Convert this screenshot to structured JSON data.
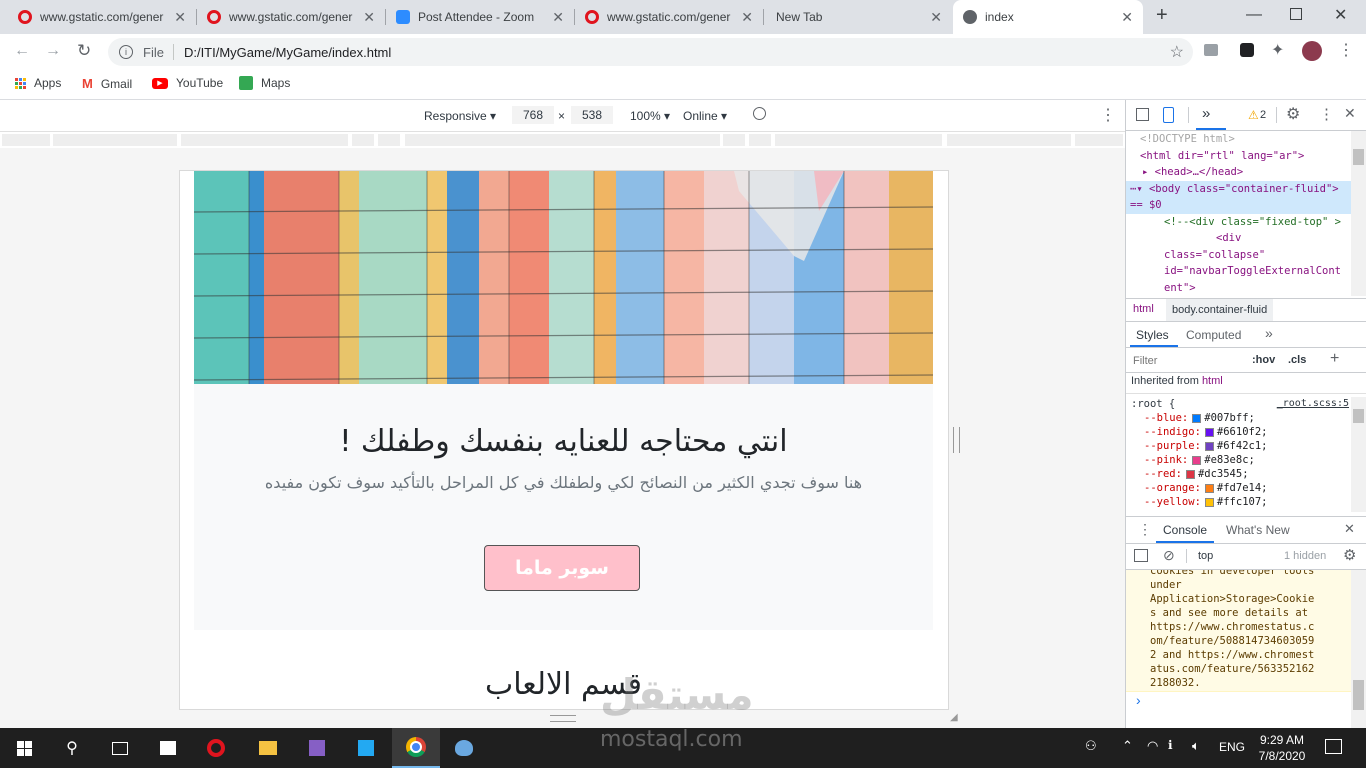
{
  "browser": {
    "tabs": [
      {
        "title": "www.gstatic.com/gener",
        "icon": "opera-icon"
      },
      {
        "title": "www.gstatic.com/gener",
        "icon": "opera-icon"
      },
      {
        "title": "Post Attendee - Zoom",
        "icon": "zoom-icon"
      },
      {
        "title": "www.gstatic.com/gener",
        "icon": "opera-icon"
      },
      {
        "title": "New Tab",
        "icon": ""
      },
      {
        "title": "index",
        "icon": "globe-icon"
      }
    ],
    "new_tab": "+",
    "address": {
      "scheme": "File",
      "path": "D:/ITI/MyGame/MyGame/index.html"
    },
    "bookmarks": [
      "Apps",
      "Gmail",
      "YouTube",
      "Maps"
    ]
  },
  "device_toolbar": {
    "mode": "Responsive",
    "width": "768",
    "times": "×",
    "height": "538",
    "zoom": "100%",
    "network": "Online"
  },
  "page": {
    "dir": "rtl",
    "headline": "انتي محتاجه للعنايه بنفسك وطفلك !",
    "lead": "هنا سوف تجدي الكثير من النصائح لكي ولطفلك في كل المراحل بالتأكيد سوف تكون مفيده",
    "cta": "سوبر ماما",
    "section_title": "قسم الالعاب",
    "colors": {
      "cta_bg": "#ffc0cb",
      "jumbo_bg": "#f8f9fa"
    }
  },
  "devtools": {
    "warnings": "2",
    "elements": [
      "<!DOCTYPE html>",
      "<html dir=\"rtl\" lang=\"ar\">",
      "<head>…</head>",
      "<body class=\"container-fluid\"> == $0",
      "<!--<div class=\"fixed-top\" >",
      "<div",
      "class=\"collapse\"",
      "id=\"navbarToggleExternalCont",
      "ent\">"
    ],
    "breadcrumbs": [
      "html",
      "body.container-fluid"
    ],
    "styles_tabs": [
      "Styles",
      "Computed"
    ],
    "filter_placeholder": "Filter",
    "hov": ":hov",
    "cls": ".cls",
    "inherited_label": "Inherited from",
    "inherited_tag": "html",
    "root_selector": ":root {",
    "root_source": "_root.scss:5",
    "vars": [
      {
        "name": "--blue:",
        "value": "#007bff;",
        "color": "#007bff"
      },
      {
        "name": "--indigo:",
        "value": "#6610f2;",
        "color": "#6610f2"
      },
      {
        "name": "--purple:",
        "value": "#6f42c1;",
        "color": "#6f42c1"
      },
      {
        "name": "--pink:",
        "value": "#e83e8c;",
        "color": "#e83e8c"
      },
      {
        "name": "--red:",
        "value": "#dc3545;",
        "color": "#dc3545"
      },
      {
        "name": "--orange:",
        "value": "#fd7e14;",
        "color": "#fd7e14"
      },
      {
        "name": "--yellow:",
        "value": "#ffc107;",
        "color": "#ffc107"
      }
    ],
    "drawer_tabs": [
      "Console",
      "What's New"
    ],
    "console_context": "top",
    "hidden_count": "1 hidden",
    "console_lines": [
      "cookies in developer tools",
      "under",
      "Application>Storage>Cookie",
      "s and see more details at",
      "https://www.chromestatus.c",
      "om/feature/508814734603059",
      "2 and https://www.chromest",
      "atus.com/feature/563352162",
      "2188032."
    ],
    "prompt": "›"
  },
  "taskbar": {
    "time": "9:29 AM",
    "date": "7/8/2020",
    "lang": "ENG"
  },
  "watermark": {
    "arabic": "مستقل",
    "latin": "mostaql.com"
  }
}
